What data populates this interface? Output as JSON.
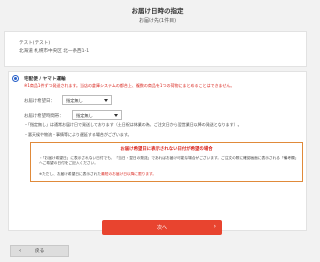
{
  "header": {
    "title": "お届け日時の指定",
    "subtitle": "お届け先(1件目)"
  },
  "address": {
    "name": "テスト(テスト)",
    "line": "北海道 札幌市中央区 北一条西1-1"
  },
  "shipping": {
    "method_label": "宅配便 / ヤマト運輸",
    "warning": "※1商品1件ずつ発送されます。当店の倉庫システムの都合上、複数の商品を1つの荷物にまとめることはできません。"
  },
  "fields": {
    "date_label": "お届け希望日：",
    "date_value": "指定無し",
    "time_label": "お届け希望時間帯：",
    "time_value": "指定無し"
  },
  "notices": [
    "・「指定無し」は通常お届け日で発送しております（土日祝は休業の為、ご注文日から翌営業日以降の発送となります）。",
    "・悪天候や物流・事情等により遅延する場合がございます。"
  ],
  "alert": {
    "title": "お届け希望日に表示されない日付が希望の場合",
    "body": "・「お届け希望日」に表示されない日付でも、「当日・翌日の発送」であればお届け可能な場合がございます。ご注文の際に確認画面に表示される「備考欄」へご希望の日付をご記入ください。",
    "body2_prefix": "※ただし、お届け希望日に表示された",
    "body2_red": "最短のお届け日以降に限ります。"
  },
  "buttons": {
    "next": "次へ",
    "back": "戻る"
  }
}
